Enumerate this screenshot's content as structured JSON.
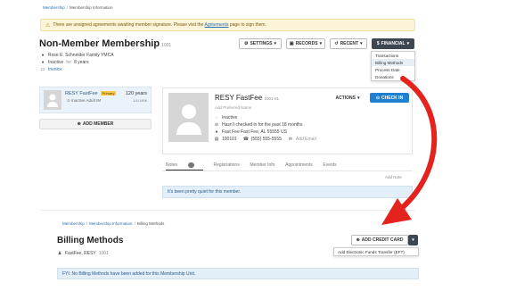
{
  "top": {
    "breadcrumb": [
      "Membership",
      "Membership Information"
    ],
    "alert_text_before": "There are unsigned agreements awaiting member signature. Please visit the ",
    "alert_link": "Agreements",
    "alert_text_after": " page to sign them.",
    "title": "Non-Member Membership",
    "title_id": "1001",
    "owner": "Rose E. Schneider Family YMCA",
    "status": "Inactive",
    "status_for": "for",
    "status_years": "8 years",
    "invoice": "Invoice",
    "buttons": {
      "settings": "SETTINGS",
      "records": "RECORDS",
      "recent": "RECENT",
      "financial": "FINANCIAL"
    },
    "financial_menu": [
      "Transactions",
      "Billing Methods",
      "Process Date",
      "Donations"
    ],
    "member_card": {
      "name": "RESY FastFee",
      "badge": "Primary",
      "age": "120 years",
      "status": "Inactive Adult IM",
      "date": "1/1/1906"
    },
    "add_member": "ADD MEMBER",
    "profile": {
      "name": "RESY FastFee",
      "id": "1001-01",
      "preferred": "Add Preferred Name",
      "status": "Inactive",
      "checkin": "Hasn't checked in for the past 18 months",
      "address": "Fast Fee Fast Fee, AL 55555 US",
      "member_no": "100101",
      "phone": "(555) 555-5555",
      "email": "Add Email",
      "actions": "ACTIONS",
      "check_in": "CHECK IN"
    },
    "tabs": [
      "Notes",
      "Registrations",
      "Member Info",
      "Appointments",
      "Events"
    ],
    "notes_count": "0",
    "add_note": "Add Note",
    "quiet_msg": "It's been pretty quiet for this member."
  },
  "bottom": {
    "breadcrumb": [
      "Membership",
      "Membership Information",
      "Billing Methods"
    ],
    "title": "Billing Methods",
    "member": "FastFee, RESY",
    "member_id": "1001",
    "add_card": "ADD CREDIT CARD",
    "dropdown_item": "Add Electronic Funds Transfer (EFT)",
    "fyi": "FYI: No Billing Methods have been added for this Membership Unit."
  },
  "colors": {
    "arrow": "#e4231f",
    "primary_blue": "#1f7fd1",
    "alert_bg": "#fdf3d8"
  }
}
